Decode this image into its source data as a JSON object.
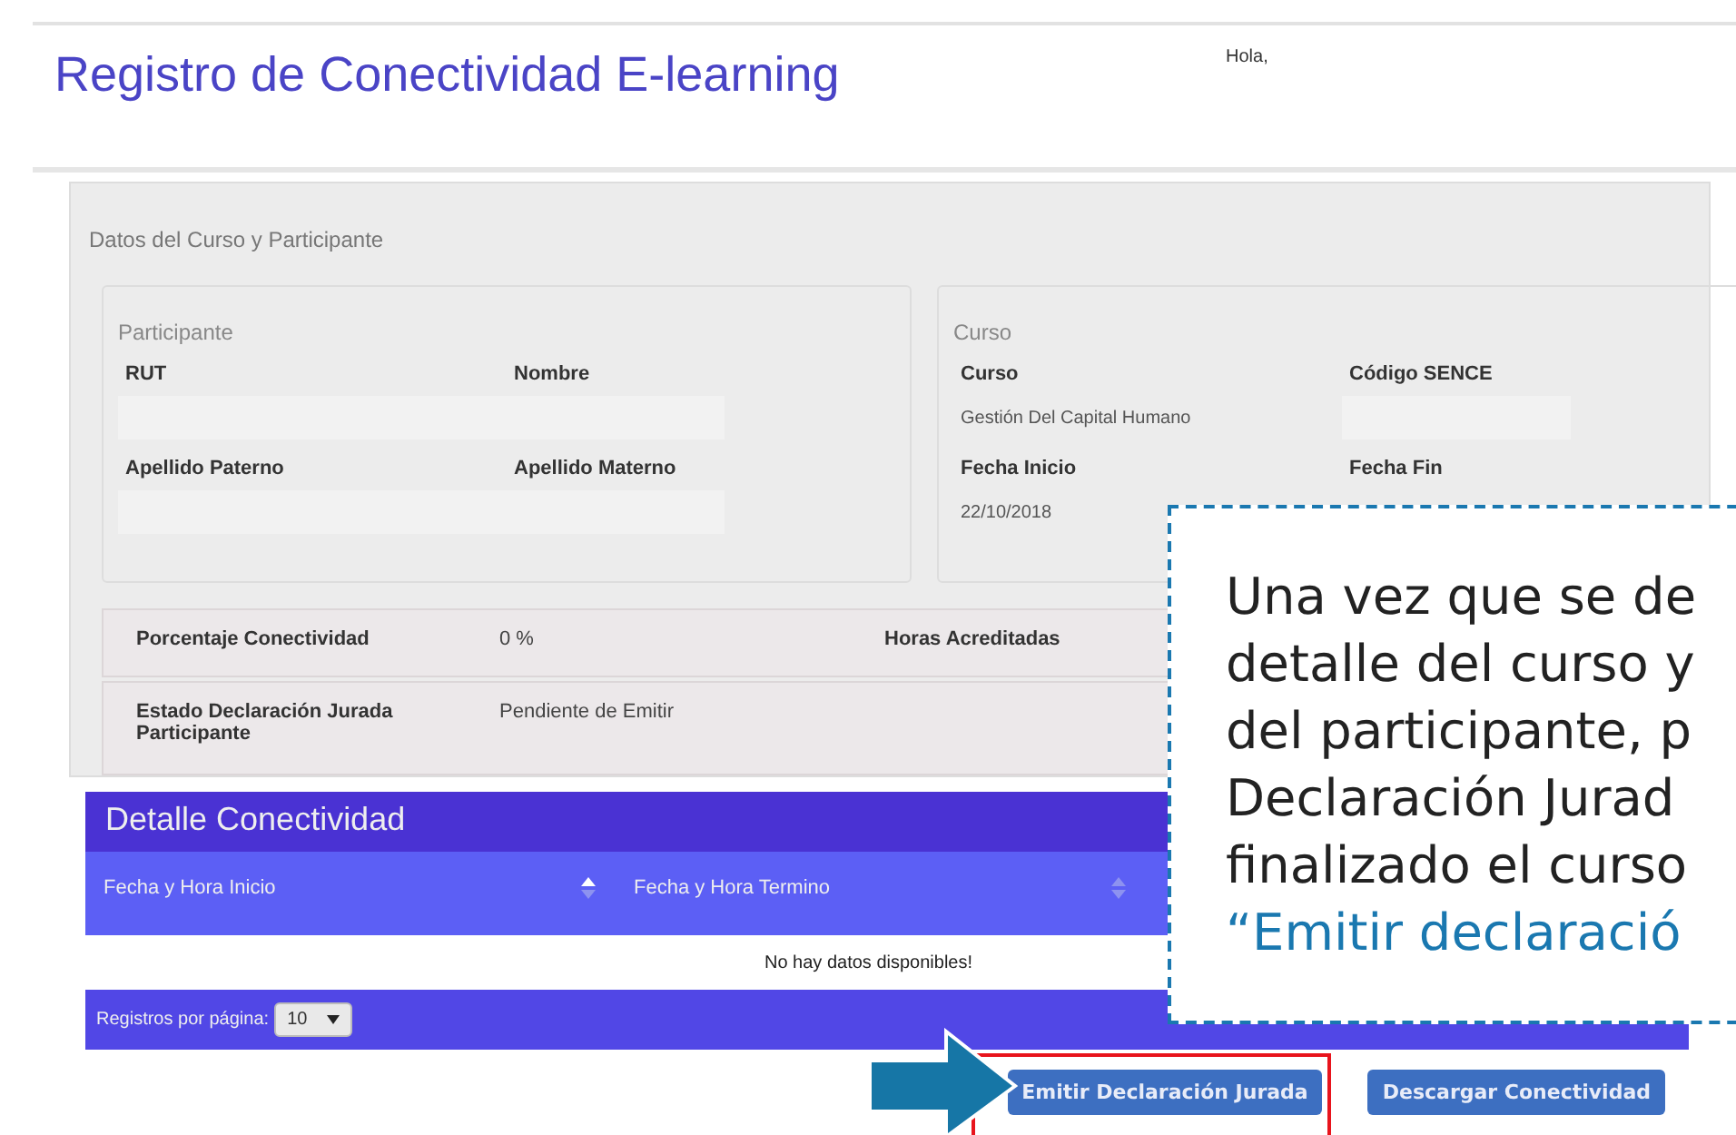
{
  "header": {
    "title": "Registro de Conectividad E-learning",
    "greeting": "Hola,"
  },
  "panel": {
    "title": "Datos del Curso y Participante",
    "participant": {
      "legend": "Participante",
      "rows": [
        {
          "labels": [
            "RUT",
            "Nombre"
          ],
          "value": ""
        },
        {
          "labels": [
            "Apellido Paterno",
            "Apellido Materno"
          ],
          "value": ""
        }
      ]
    },
    "course": {
      "legend": "Curso",
      "rows": [
        {
          "labels": [
            "Curso",
            "Código SENCE"
          ],
          "value": "Gestión Del Capital Humano",
          "empty_field": true
        },
        {
          "labels": [
            "Fecha Inicio",
            "Fecha Fin"
          ],
          "value": "22/10/2018"
        }
      ]
    },
    "stats": [
      {
        "label": "Porcentaje Conectividad",
        "value": "0 %",
        "label_2": "Horas Acreditadas"
      },
      {
        "label": "Estado Declaración Jurada Participante",
        "value": "Pendiente de Emitir"
      }
    ]
  },
  "detail": {
    "title": "Detalle Conectividad",
    "columns": [
      {
        "label": "Fecha y Hora Inicio",
        "sorted": true
      },
      {
        "label": "Fecha y Hora Termino",
        "sorted": false
      }
    ],
    "empty_message": "No hay datos disponibles!",
    "page_size_label": "Registros por página:",
    "page_size": "10"
  },
  "buttons": [
    {
      "label": "Emitir Declaración Jurada",
      "highlighted": true
    },
    {
      "label": "Descargar Conectividad",
      "highlighted": false
    }
  ],
  "callout": {
    "lines": [
      {
        "text": "Una vez que se de",
        "kind": "body"
      },
      {
        "text": "detalle del curso y",
        "kind": "body"
      },
      {
        "text": "del participante, p",
        "kind": "body"
      },
      {
        "text": "Declaración Jurad",
        "kind": "body"
      },
      {
        "text": "finalizado el curso",
        "kind": "body"
      },
      {
        "text": "“Emitir declaració",
        "kind": "highlight"
      }
    ]
  }
}
